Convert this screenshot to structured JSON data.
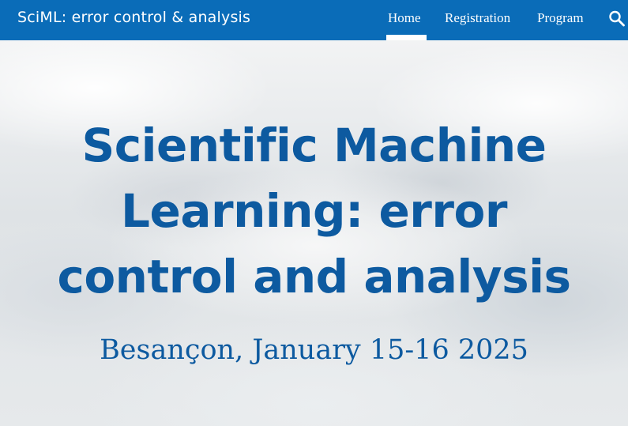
{
  "header": {
    "site_title": "SciML: error control & analysis",
    "nav": [
      {
        "label": "Home",
        "active": true
      },
      {
        "label": "Registration",
        "active": false
      },
      {
        "label": "Program",
        "active": false
      }
    ],
    "search_icon": "search-icon",
    "bg_color": "#0a6cb8"
  },
  "hero": {
    "title_lines": [
      "Scientific Machine",
      "Learning: error",
      "control and analysis"
    ],
    "subtitle": "Besançon, January 15-16 2025",
    "text_color": "#0d5aa0"
  }
}
